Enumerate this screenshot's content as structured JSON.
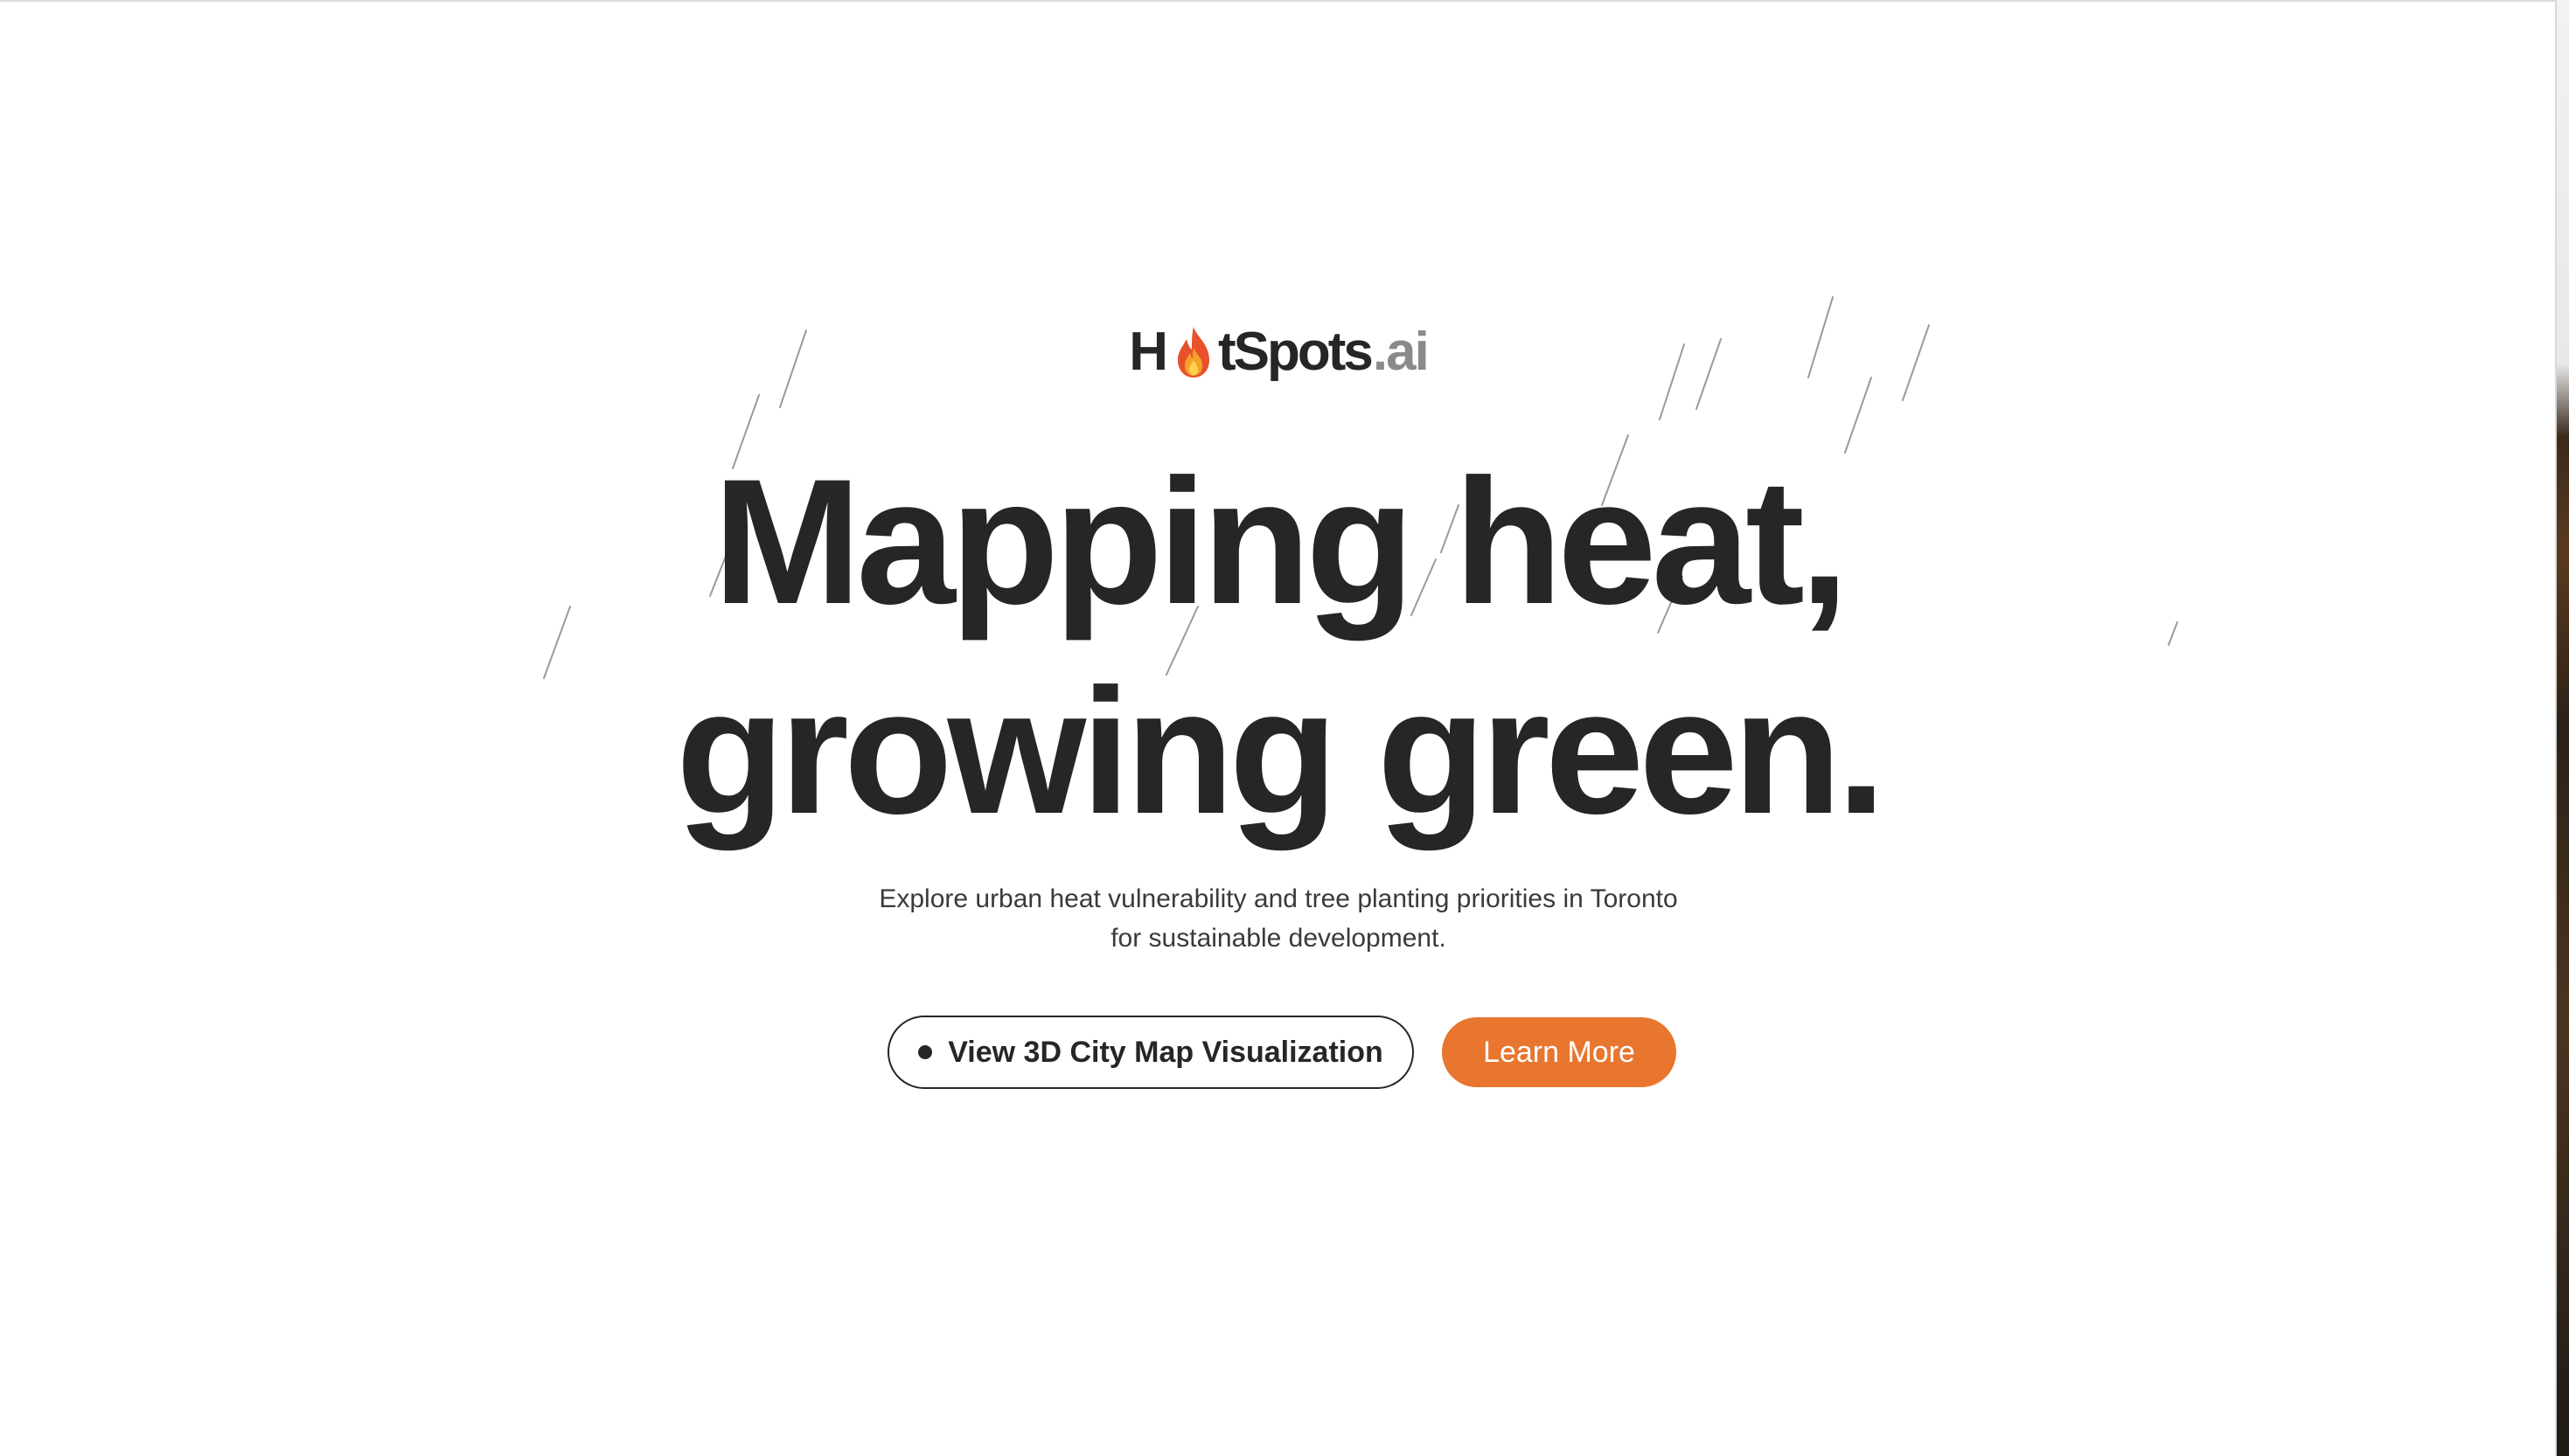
{
  "brand": {
    "logo_prefix": "H",
    "logo_suffix": "tSpots",
    "logo_domain": ".ai",
    "flame_icon": "fire-icon",
    "accent_color": "#e8762f"
  },
  "hero": {
    "headline_line1": "Mapping heat,",
    "headline_line2": "growing green.",
    "subtitle_line1": "Explore urban heat vulnerability and tree planting priorities in Toronto",
    "subtitle_line2": "for sustainable development."
  },
  "actions": {
    "map_button_label": "View 3D City Map Visualization",
    "map_button_icon": "dot-icon",
    "learn_more_label": "Learn More"
  }
}
